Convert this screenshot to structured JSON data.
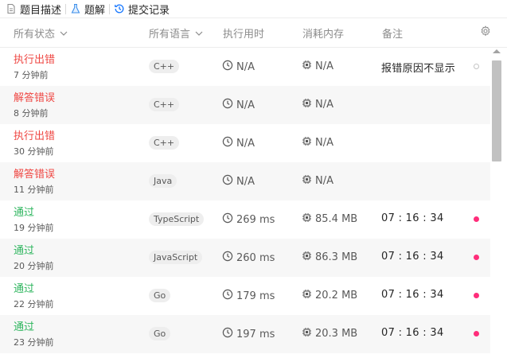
{
  "tabs": [
    {
      "label": "题目描述",
      "icon": "document-icon"
    },
    {
      "label": "题解",
      "icon": "flask-icon"
    },
    {
      "label": "提交记录",
      "icon": "history-icon"
    }
  ],
  "table": {
    "headers": {
      "status": "所有状态",
      "language": "所有语言",
      "time": "执行用时",
      "memory": "消耗内存",
      "note": "备注"
    },
    "rows": [
      {
        "status": "执行出错",
        "status_color": "#ef4743",
        "ago": "7 分钟前",
        "language": "C++",
        "time": "N/A",
        "memory": "N/A",
        "note": "报错原因不显示",
        "marker": "hollow"
      },
      {
        "status": "解答错误",
        "status_color": "#ef4743",
        "ago": "8 分钟前",
        "language": "C++",
        "time": "N/A",
        "memory": "N/A",
        "note": "",
        "marker": "none"
      },
      {
        "status": "执行出错",
        "status_color": "#ef4743",
        "ago": "30 分钟前",
        "language": "C++",
        "time": "N/A",
        "memory": "N/A",
        "note": "",
        "marker": "none"
      },
      {
        "status": "解答错误",
        "status_color": "#ef4743",
        "ago": "11 分钟前",
        "language": "Java",
        "time": "N/A",
        "memory": "N/A",
        "note": "",
        "marker": "none"
      },
      {
        "status": "通过",
        "status_color": "#2db55d",
        "ago": "19 分钟前",
        "language": "TypeScript",
        "time": "269 ms",
        "memory": "85.4 MB",
        "note": "07 : 16 : 34",
        "marker": "pink"
      },
      {
        "status": "通过",
        "status_color": "#2db55d",
        "ago": "20 分钟前",
        "language": "JavaScript",
        "time": "260 ms",
        "memory": "86.3 MB",
        "note": "07 : 16 : 34",
        "marker": "pink"
      },
      {
        "status": "通过",
        "status_color": "#2db55d",
        "ago": "22 分钟前",
        "language": "Go",
        "time": "179 ms",
        "memory": "20.2 MB",
        "note": "07 : 16 : 34",
        "marker": "pink"
      },
      {
        "status": "通过",
        "status_color": "#2db55d",
        "ago": "23 分钟前",
        "language": "Go",
        "time": "197 ms",
        "memory": "20.3 MB",
        "note": "07 : 16 : 34",
        "marker": "pink"
      }
    ]
  },
  "colors": {
    "error": "#ef4743",
    "accepted": "#2db55d",
    "marker": "#ff2d7a"
  }
}
